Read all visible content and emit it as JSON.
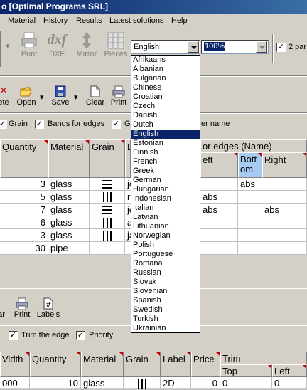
{
  "window": {
    "title": "o [Optimal Programs SRL]"
  },
  "menu": [
    "Material",
    "History",
    "Results",
    "Latest solutions",
    "Help"
  ],
  "toolbar1": {
    "print_label": "Print",
    "dxf_label": "DXF",
    "mirror_label": "Mirror",
    "pieces_label": "Pieces",
    "language_value": "English",
    "zoom_value": "100%",
    "checkbox_label": "2 par",
    "checkbox_checked": "✓"
  },
  "toolbar2": {
    "delete_label": "ete",
    "open_label": "Open",
    "save_label": "Save",
    "clear_label": "Clear",
    "print_label": "Print"
  },
  "options_row": {
    "grain_label": "Grain",
    "bands_label": "Bands for edges",
    "g_label": "G",
    "name_label": "er name",
    "check_mark": "✓"
  },
  "grid1": {
    "bands_header": "or edges (Name)",
    "headers": {
      "quantity": "Quantity",
      "material": "Material",
      "grain": "Grain",
      "label": "L",
      "left": "eft",
      "bottom": "Bottom",
      "right": "Right"
    },
    "rows": [
      {
        "quantity": "3",
        "material": "glass",
        "grain": "horizontal",
        "label": "jc",
        "left": "",
        "bottom": "abs",
        "right": ""
      },
      {
        "quantity": "5",
        "material": "glass",
        "grain": "vertical",
        "label": "r",
        "left": "abs",
        "bottom": "",
        "right": ""
      },
      {
        "quantity": "7",
        "material": "glass",
        "grain": "horizontal",
        "label": "jc",
        "left": "abs",
        "bottom": "",
        "right": "abs"
      },
      {
        "quantity": "6",
        "material": "glass",
        "grain": "vertical",
        "label": "a",
        "left": "",
        "bottom": "",
        "right": ""
      },
      {
        "quantity": "3",
        "material": "glass",
        "grain": "vertical",
        "label": "ja",
        "left": "",
        "bottom": "",
        "right": ""
      },
      {
        "quantity": "30",
        "material": "pipe",
        "grain": "none",
        "label": "",
        "left": "",
        "bottom": "",
        "right": ""
      }
    ]
  },
  "lower_toolbar": {
    "clear_label": "ar",
    "print_label": "Print",
    "labels_label": "Labels",
    "trim_label": "Trim the edge",
    "priority_label": "Priority",
    "check_mark": "✓"
  },
  "grid2": {
    "headers": {
      "width": "Vidth",
      "quantity": "Quantity",
      "material": "Material",
      "grain": "Grain",
      "label": "Label",
      "price": "Price",
      "trim": "Trim",
      "top": "Top",
      "left": "Left"
    },
    "row": {
      "width": "000",
      "quantity": "10",
      "material": "glass",
      "grain": "vertical",
      "label": "2D",
      "price": "0",
      "top": "0",
      "left": "0"
    }
  },
  "language_dropdown": {
    "selected": "English",
    "options": [
      "Afrikaans",
      "Albanian",
      "Bulgarian",
      "Chinese",
      "Croatian",
      "Czech",
      "Danish",
      "Dutch",
      "English",
      "Estonian",
      "Finnish",
      "French",
      "Greek",
      "German",
      "Hungarian",
      "Indonesian",
      "Italian",
      "Latvian",
      "Lithuanian",
      "Norwegian",
      "Polish",
      "Portuguese",
      "Romana",
      "Russian",
      "Slovak",
      "Slovenian",
      "Spanish",
      "Swedish",
      "Turkish",
      "Ukrainian"
    ]
  },
  "colors": {
    "titlebar": "#0a246a",
    "selection": "#0a246a",
    "header_selected": "#a6caf0",
    "corner_marker": "#c00000",
    "face": "#d4d0c8"
  }
}
